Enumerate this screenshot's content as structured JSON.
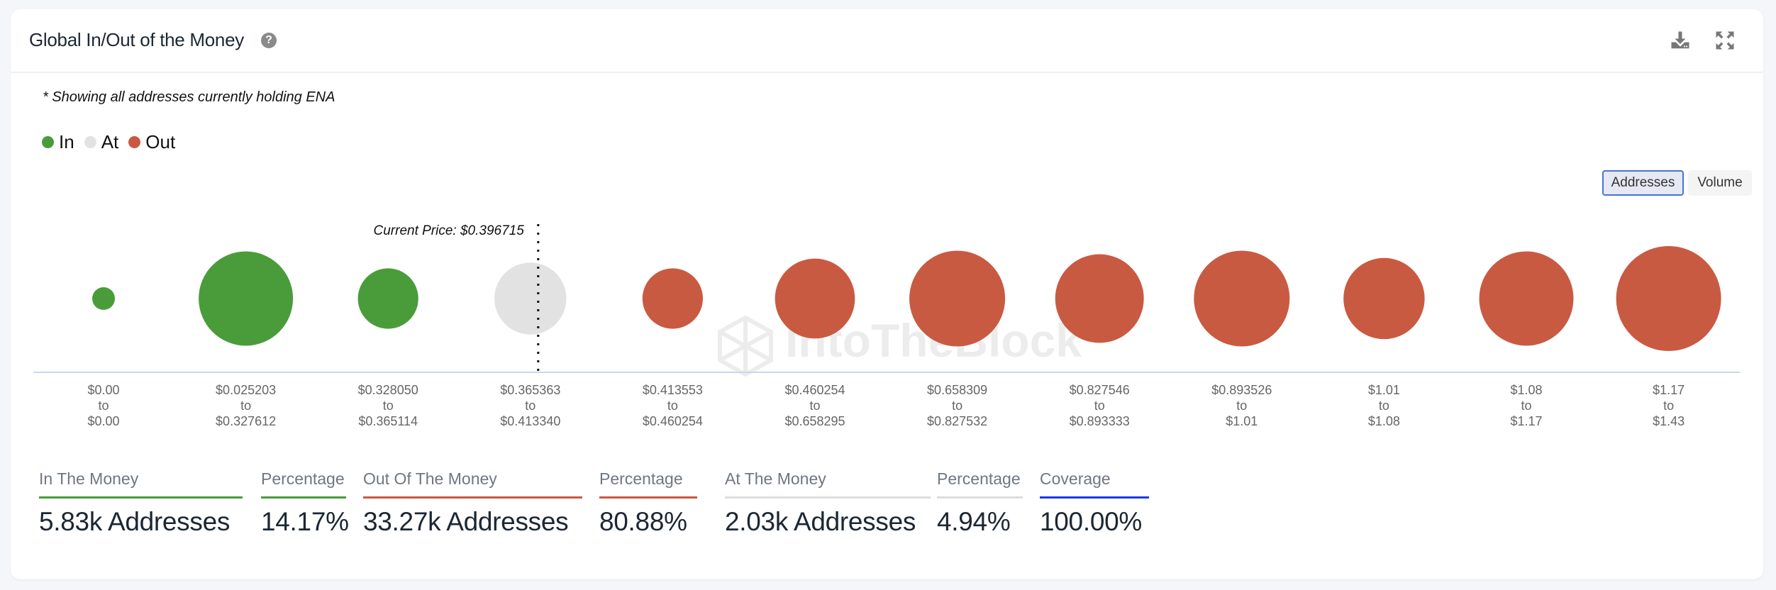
{
  "header": {
    "title": "Global In/Out of the Money",
    "help_icon": "question-circle-icon",
    "download_icon": "download-icon",
    "expand_icon": "expand-icon"
  },
  "note": "* Showing all addresses currently holding ENA",
  "legend": [
    {
      "label": "In",
      "color": "#4a9c3b"
    },
    {
      "label": "At",
      "color": "#e2e2e2"
    },
    {
      "label": "Out",
      "color": "#c95a42"
    }
  ],
  "toggle": {
    "active": "Addresses",
    "inactive": "Volume"
  },
  "watermark": "IntoTheBlock",
  "chart_data": {
    "type": "scatter",
    "title": "Global In/Out of the Money",
    "subtitle": "* Showing all addresses currently holding ENA",
    "current_price_label": "Current Price: $0.396715",
    "current_price": 0.396715,
    "current_price_bucket_index": 3,
    "size_metric": "Addresses (relative bubble size)",
    "categories": [
      {
        "from": "$0.00",
        "to": "$0.00",
        "status": "In",
        "relative_size": 0.05
      },
      {
        "from": "$0.025203",
        "to": "$0.327612",
        "status": "In",
        "relative_size": 0.77
      },
      {
        "from": "$0.328050",
        "to": "$0.365114",
        "status": "In",
        "relative_size": 0.25
      },
      {
        "from": "$0.365363",
        "to": "$0.413340",
        "status": "At",
        "relative_size": 0.39
      },
      {
        "from": "$0.413553",
        "to": "$0.460254",
        "status": "Out",
        "relative_size": 0.25
      },
      {
        "from": "$0.460254",
        "to": "$0.658295",
        "status": "Out",
        "relative_size": 0.51
      },
      {
        "from": "$0.658309",
        "to": "$0.827532",
        "status": "Out",
        "relative_size": 0.8
      },
      {
        "from": "$0.827546",
        "to": "$0.893333",
        "status": "Out",
        "relative_size": 0.66
      },
      {
        "from": "$0.893526",
        "to": "$1.01",
        "status": "Out",
        "relative_size": 0.8
      },
      {
        "from": "$1.01",
        "to": "$1.08",
        "status": "Out",
        "relative_size": 0.53
      },
      {
        "from": "$1.08",
        "to": "$1.17",
        "status": "Out",
        "relative_size": 0.77
      },
      {
        "from": "$1.17",
        "to": "$1.43",
        "status": "Out",
        "relative_size": 1.0
      }
    ],
    "connector": "to",
    "colors": {
      "In": "#4a9c3b",
      "At": "#e2e2e2",
      "Out": "#c95a42"
    }
  },
  "stats": [
    {
      "label": "In The Money",
      "value": "5.83k Addresses",
      "color": "#4a9c3b"
    },
    {
      "label": "Percentage",
      "value": "14.17%",
      "color": "#4a9c3b"
    },
    {
      "label": "Out Of The Money",
      "value": "33.27k Addresses",
      "color": "#c95a42"
    },
    {
      "label": "Percentage",
      "value": "80.88%",
      "color": "#c95a42"
    },
    {
      "label": "At The Money",
      "value": "2.03k Addresses",
      "color": "#dcdcdc"
    },
    {
      "label": "Percentage",
      "value": "4.94%",
      "color": "#dcdcdc"
    },
    {
      "label": "Coverage",
      "value": "100.00%",
      "color": "#1a3ae6"
    }
  ]
}
